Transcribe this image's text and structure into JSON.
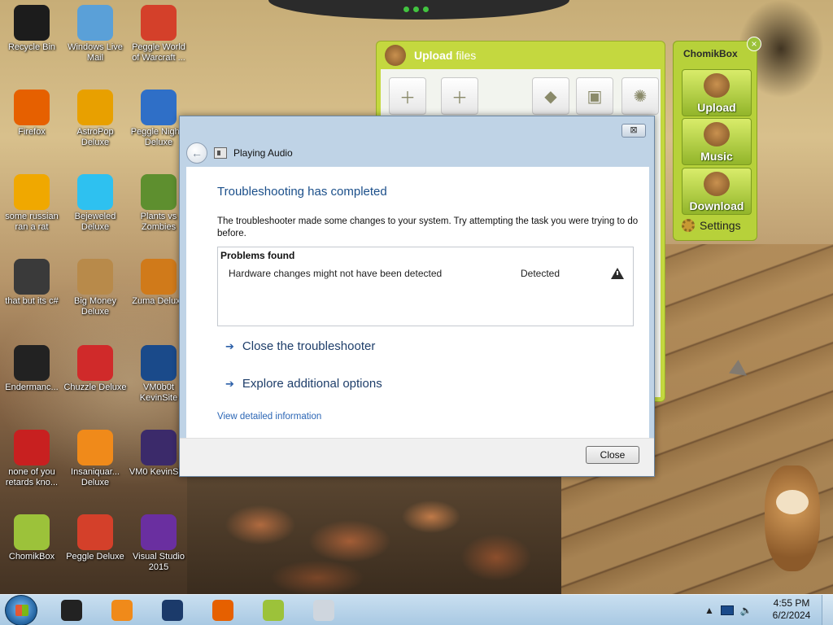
{
  "desktop_icons": [
    {
      "label": "Recycle Bin",
      "icon": "recycle-bin-icon",
      "color": "#1c1c1c"
    },
    {
      "label": "Windows Live Mail",
      "icon": "mail-icon",
      "color": "#5aa0d8"
    },
    {
      "label": "Peggle World of Warcraft ...",
      "icon": "peggle-icon",
      "color": "#d4402a"
    },
    {
      "label": "Firefox",
      "icon": "firefox-icon",
      "color": "#e66000"
    },
    {
      "label": "AstroPop Deluxe",
      "icon": "astropop-icon",
      "color": "#e8a000"
    },
    {
      "label": "Peggle Nights Deluxe",
      "icon": "peggle-nights-icon",
      "color": "#2f6fc7"
    },
    {
      "label": "some russian ran a rat",
      "icon": "de-icon",
      "color": "#f0a800"
    },
    {
      "label": "Bejeweled Deluxe",
      "icon": "diamond-icon",
      "color": "#2ec1f0"
    },
    {
      "label": "Plants vs Zombies",
      "icon": "plants-icon",
      "color": "#5e8f2f"
    },
    {
      "label": "that but its c#",
      "icon": "window-stack-icon",
      "color": "#3a3a3a"
    },
    {
      "label": "Big Money Deluxe",
      "icon": "money-bag-icon",
      "color": "#b88a4a"
    },
    {
      "label": "Zuma Deluxe",
      "icon": "zuma-icon",
      "color": "#d07a1a"
    },
    {
      "label": "Endermanc...",
      "icon": "terminal-icon",
      "color": "#222222"
    },
    {
      "label": "Chuzzle Deluxe",
      "icon": "chuzzle-icon",
      "color": "#d02a2a"
    },
    {
      "label": "VM0b0t KevinSite",
      "icon": "monitor-icon",
      "color": "#1a4a8a"
    },
    {
      "label": "none of you retards kno...",
      "icon": "dragon-icon",
      "color": "#c82020"
    },
    {
      "label": "Insaniquar... Deluxe",
      "icon": "fish-icon",
      "color": "#f08a1a"
    },
    {
      "label": "VM0 KevinSi...",
      "icon": "firefox-file-icon",
      "color": "#3b2a6a"
    },
    {
      "label": "ChomikBox",
      "icon": "chomikbox-icon",
      "color": "#9cc23a"
    },
    {
      "label": "Peggle Deluxe",
      "icon": "peggle-deluxe-icon",
      "color": "#d4402a"
    },
    {
      "label": "Visual Studio 2015",
      "icon": "visual-studio-icon",
      "color": "#6a2fa0"
    }
  ],
  "upload_window": {
    "title_bold": "Upload",
    "title_rest": "files",
    "accent": "#c4d83f"
  },
  "chomikbox": {
    "title": "ChomikBox",
    "close": "×",
    "buttons": [
      {
        "label": "Upload",
        "icon": "hamster-upload-icon"
      },
      {
        "label": "Music",
        "icon": "hamster-music-icon"
      },
      {
        "label": "Download",
        "icon": "hamster-download-icon"
      }
    ],
    "settings_label": "Settings"
  },
  "dialog": {
    "close_glyph": "⊠",
    "app_title": "Playing Audio",
    "heading": "Troubleshooting has completed",
    "description": "The troubleshooter made some changes to your system. Try attempting the task you were trying to do before.",
    "problems_title": "Problems found",
    "problems": [
      {
        "description": "Hardware changes might not have been detected",
        "status": "Detected",
        "icon": "warning-icon"
      }
    ],
    "options": [
      {
        "label": "Close the troubleshooter",
        "icon": "arrow-right-icon"
      },
      {
        "label": "Explore additional options",
        "icon": "arrow-right-icon"
      }
    ],
    "detail_link": "View detailed information",
    "close_button": "Close"
  },
  "taskbar": {
    "apps": [
      "terminal-icon",
      "media-player-icon",
      "globe-icon",
      "firefox-icon",
      "chomikbox-icon",
      "file-icon"
    ],
    "time": "4:55 PM",
    "date": "6/2/2024"
  }
}
